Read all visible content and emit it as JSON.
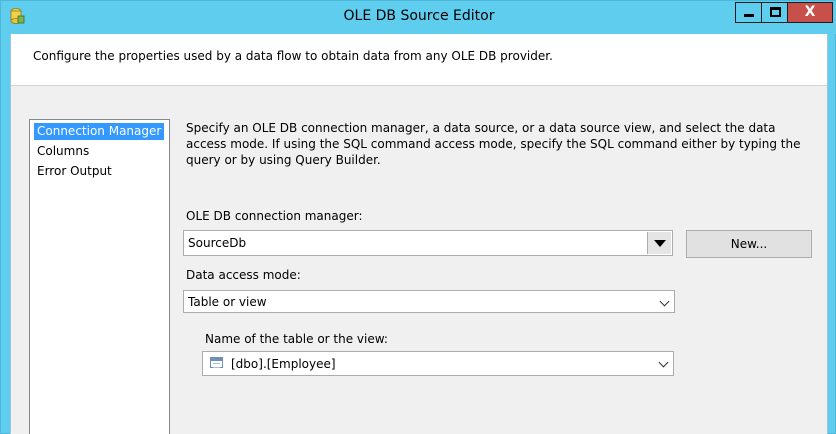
{
  "window": {
    "title": "OLE DB Source Editor",
    "close_glyph": "X"
  },
  "header": {
    "text": "Configure the properties used by a data flow to obtain data from any OLE DB provider."
  },
  "nav": {
    "items": [
      {
        "label": "Connection Manager",
        "selected": true
      },
      {
        "label": "Columns",
        "selected": false
      },
      {
        "label": "Error Output",
        "selected": false
      }
    ]
  },
  "main": {
    "description": "Specify an OLE DB connection manager, a data source, or a data source view, and select the data access mode. If using the SQL command access mode, specify the SQL command either by typing the query or by using Query Builder.",
    "connection_manager_label": "OLE DB connection manager:",
    "connection_manager_value": "SourceDb",
    "new_button": "New...",
    "access_mode_label": "Data access mode:",
    "access_mode_value": "Table or view",
    "table_name_label": "Name of the table or the view:",
    "table_name_value": "[dbo].[Employee]"
  },
  "colors": {
    "titlebar": "#5fcdee",
    "close_button": "#c7504a",
    "selection": "#3399ff"
  }
}
